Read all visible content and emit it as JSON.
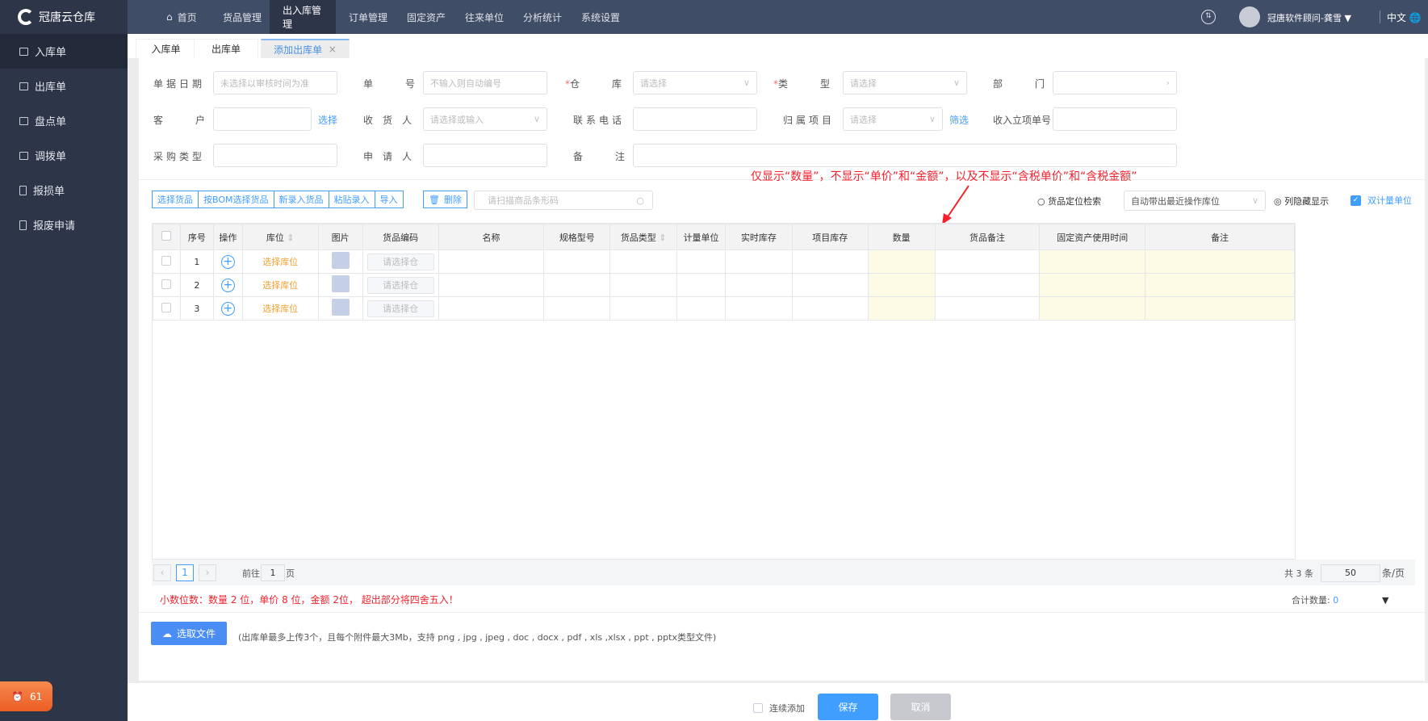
{
  "app": {
    "name": "冠唐云仓库"
  },
  "nav": {
    "items": [
      "首页",
      "货品管理",
      "出入库管理",
      "订单管理",
      "固定资产",
      "往来单位",
      "分析统计",
      "系统设置"
    ],
    "active": "出入库管理"
  },
  "user": {
    "name": "冠唐软件顾问-龚雪",
    "lang": "中文"
  },
  "sidebar": {
    "items": [
      "入库单",
      "出库单",
      "盘点单",
      "调拨单",
      "报损单",
      "报废申请"
    ],
    "active": "入库单"
  },
  "badge": {
    "count": "61"
  },
  "tabs": [
    {
      "label": "入库单"
    },
    {
      "label": "出库单"
    },
    {
      "label": "添加出库单",
      "close": "×"
    }
  ],
  "form": {
    "date": {
      "label": "单据日期",
      "placeholder": "未选择以审核时间为准"
    },
    "number": {
      "label": "单号",
      "placeholder": "不输入则自动编号"
    },
    "warehouse": {
      "label": "仓库",
      "placeholder": "请选择",
      "required": "*"
    },
    "type": {
      "label": "类型",
      "placeholder": "请选择",
      "required": "*"
    },
    "dept": {
      "label": "部门"
    },
    "customer": {
      "label": "客户",
      "link": "选择"
    },
    "receiver": {
      "label": "收货人",
      "placeholder": "请选择或输入"
    },
    "phone": {
      "label": "联系电话"
    },
    "project": {
      "label": "归属项目",
      "placeholder": "请选择",
      "link": "筛选"
    },
    "income": {
      "label": "收入立项单号"
    },
    "purchase_type": {
      "label": "采购类型"
    },
    "applicant": {
      "label": "申请人"
    },
    "remark": {
      "label": "备注"
    }
  },
  "annotation": "仅显示“数量”，不显示“单价”和“金额”，以及不显示“含税单价”和“含税金额”",
  "toolbar": {
    "buttons": [
      "选择货品",
      "按BOM选择货品",
      "新录入货品",
      "粘贴录入",
      "导入"
    ],
    "delete": "删除",
    "scan_placeholder": "请扫描商品条形码",
    "locate": "货品定位检索",
    "location_select": "自动带出最近操作库位",
    "column_toggle": "列隐藏显示",
    "dual_unit": "双计量单位"
  },
  "table": {
    "columns": [
      "",
      "序号",
      "操作",
      "库位",
      "图片",
      "货品编码",
      "名称",
      "规格型号",
      "货品类型",
      "计量单位",
      "实时库存",
      "项目库存",
      "数量",
      "货品备注",
      "固定资产使用时间",
      "备注"
    ],
    "rows": [
      {
        "index": "1",
        "location": "选择库位",
        "code_placeholder": "请选择仓"
      },
      {
        "index": "2",
        "location": "选择库位",
        "code_placeholder": "请选择仓"
      },
      {
        "index": "3",
        "location": "选择库位",
        "code_placeholder": "请选择仓"
      }
    ]
  },
  "pager": {
    "page": "1",
    "goto_label": "前往",
    "goto_value": "1",
    "page_suffix": "页",
    "total": "共 3 条",
    "page_size": "50",
    "size_suffix": "条/页"
  },
  "decimal_note": "小数位数：数量 2 位，单价 8 位，金额 2位， 超出部分将四舍五入！",
  "summary": {
    "label": "合计数量:",
    "value": "0"
  },
  "upload": {
    "button": "选取文件",
    "hint": "(出库单最多上传3个，且每个附件最大3Mb，支持 png , jpg , jpeg , doc , docx , pdf , xls ,xlsx , ppt , pptx类型文件)"
  },
  "footer": {
    "continuous": "连续添加",
    "save": "保存",
    "cancel": "取消"
  },
  "colors": {
    "topbar": "#404d66",
    "sidebar": "#2d3648",
    "accent": "#409eff",
    "warning": "#f5222d",
    "highlight": "#fdfbe6"
  }
}
